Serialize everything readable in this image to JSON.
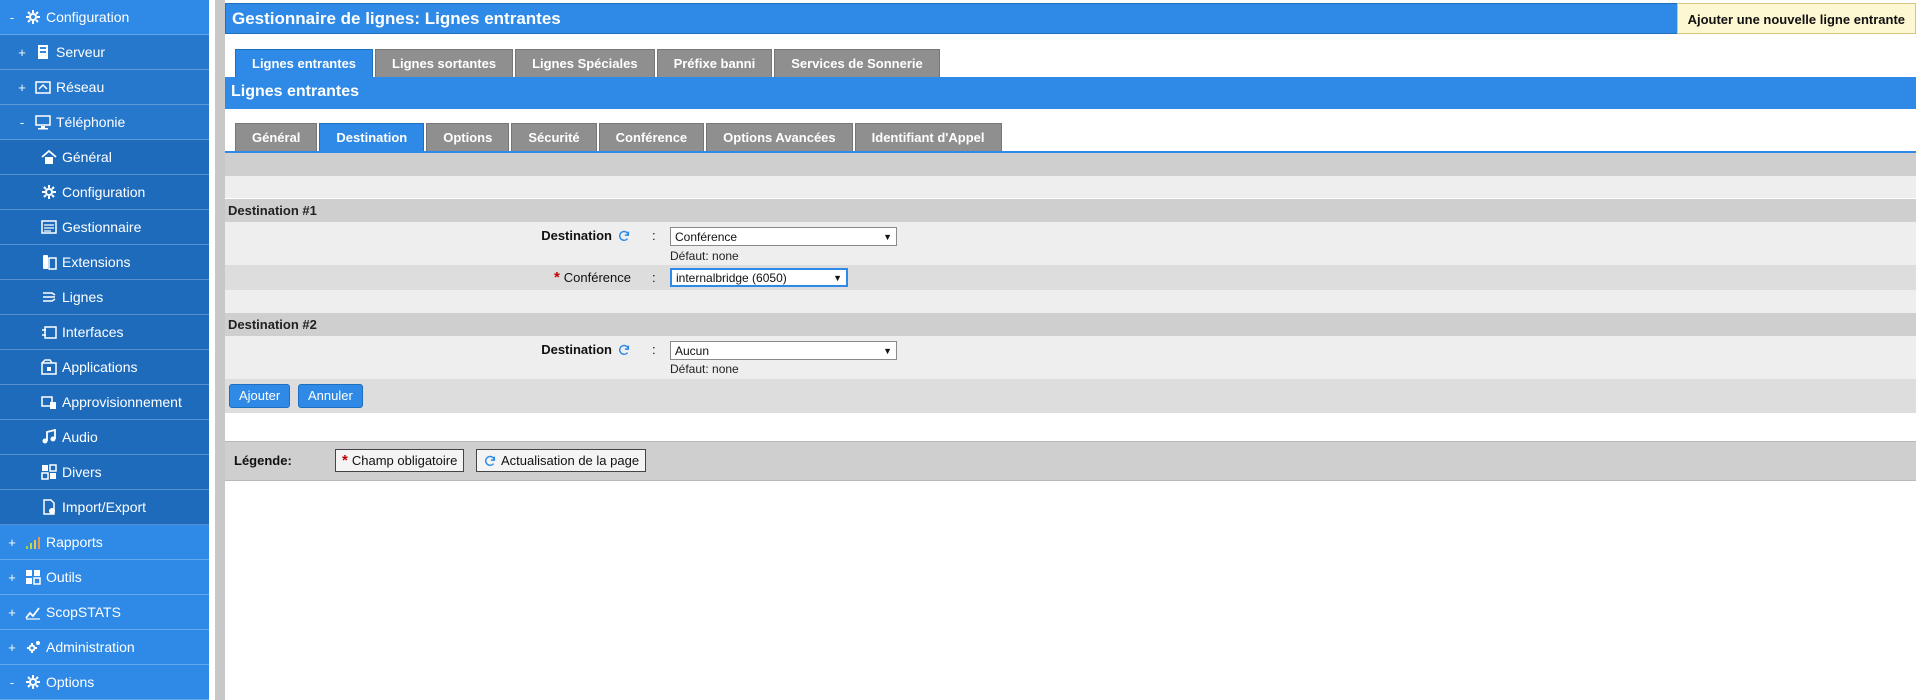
{
  "sidebar": {
    "items": [
      {
        "toggle": "-",
        "label": "Configuration",
        "icon": "gear-icon"
      },
      {
        "toggle": "+",
        "label": "Serveur",
        "icon": "server-icon"
      },
      {
        "toggle": "+",
        "label": "Réseau",
        "icon": "network-icon"
      },
      {
        "toggle": "-",
        "label": "Téléphonie",
        "icon": "telephony-icon"
      },
      {
        "label": "Général",
        "icon": "home-icon"
      },
      {
        "label": "Configuration",
        "icon": "gear-icon"
      },
      {
        "label": "Gestionnaire",
        "icon": "manager-icon"
      },
      {
        "label": "Extensions",
        "icon": "phone-icon"
      },
      {
        "label": "Lignes",
        "icon": "lines-icon"
      },
      {
        "label": "Interfaces",
        "icon": "interfaces-icon"
      },
      {
        "label": "Applications",
        "icon": "applications-icon"
      },
      {
        "label": "Approvisionnement",
        "icon": "provisioning-icon"
      },
      {
        "label": "Audio",
        "icon": "music-note-icon"
      },
      {
        "label": "Divers",
        "icon": "grid-icon"
      },
      {
        "label": "Import/Export",
        "icon": "import-export-icon"
      },
      {
        "toggle": "+",
        "label": "Rapports",
        "icon": "bar-chart-icon"
      },
      {
        "toggle": "+",
        "label": "Outils",
        "icon": "tools-icon"
      },
      {
        "toggle": "+",
        "label": "ScopSTATS",
        "icon": "stats-icon"
      },
      {
        "toggle": "+",
        "label": "Administration",
        "icon": "admin-gear-icon"
      },
      {
        "toggle": "-",
        "label": "Options",
        "icon": "gear-icon"
      }
    ]
  },
  "header": {
    "title": "Gestionnaire de lignes:  Lignes entrantes",
    "add_button": "Ajouter une nouvelle ligne entrante"
  },
  "top_tabs": [
    "Lignes entrantes",
    "Lignes sortantes",
    "Lignes Spéciales",
    "Préfixe banni",
    "Services de Sonnerie"
  ],
  "section_title": "Lignes entrantes",
  "sub_tabs": [
    "Général",
    "Destination",
    "Options",
    "Sécurité",
    "Conférence",
    "Options Avancées",
    "Identifiant d'Appel"
  ],
  "form": {
    "dest1_title": "Destination #1",
    "dest1_label": "Destination",
    "dest1_value": "Conférence",
    "dest1_default": "Défaut: none",
    "conf_required": "*",
    "conf_label": "Conférence",
    "conf_value": "internalbridge (6050)",
    "dest2_title": "Destination #2",
    "dest2_label": "Destination",
    "dest2_value": "Aucun",
    "dest2_default": "Défaut: none",
    "colon": ":"
  },
  "buttons": {
    "add": "Ajouter",
    "cancel": "Annuler"
  },
  "legend": {
    "title": "Légende:",
    "required_star": "*",
    "required": "Champ obligatoire",
    "refresh": "Actualisation de la page"
  },
  "colors": {
    "accent": "#2e8ae6",
    "required": "#c00000",
    "tab_inactive": "#8f8f8f"
  }
}
